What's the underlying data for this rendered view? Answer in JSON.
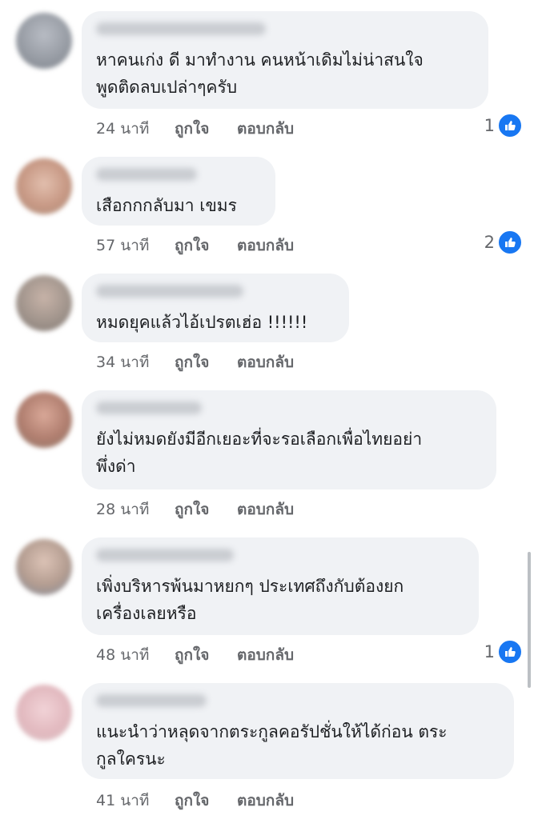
{
  "comments": [
    {
      "text_line1": "หาคนเก่ง ดี มาทำงาน คนหน้าเดิมไม่น่าสนใจ",
      "text_line2": "พูดติดลบเปล่าๆครับ",
      "time": "24 นาที",
      "like_label": "ถูกใจ",
      "reply_label": "ตอบกลับ",
      "reaction_count": "1",
      "avatar_color": "#9a9fa8"
    },
    {
      "text_line1": "เสือกกกลับมา เขมร",
      "text_line2": "",
      "time": "57 นาที",
      "like_label": "ถูกใจ",
      "reply_label": "ตอบกลับ",
      "reaction_count": "2",
      "avatar_color": "#c9a493"
    },
    {
      "text_line1": "หมดยุคแล้วไอ้เปรตเฮ่อ !!!!!!",
      "text_line2": "",
      "time": "34 นาที",
      "like_label": "ถูกใจ",
      "reply_label": "ตอบกลับ",
      "reaction_count": "",
      "avatar_color": "#a89a92"
    },
    {
      "text_line1": "ยังไม่หมดยังมีอีกเยอะที่จะรอเลือกเพื่อไทยอย่า",
      "text_line2": "พึ่งด่า",
      "time": "28 นาที",
      "like_label": "ถูกใจ",
      "reply_label": "ตอบกลับ",
      "reaction_count": "",
      "avatar_color": "#b98a7a"
    },
    {
      "text_line1": "เพิ่งบริหารพ้นมาหยกๆ ประเทศถึงกับต้องยก",
      "text_line2": "เครื่องเลยหรือ",
      "time": "48 นาที",
      "like_label": "ถูกใจ",
      "reply_label": "ตอบกลับ",
      "reaction_count": "1",
      "avatar_color": "#b39c90"
    },
    {
      "text_line1": "แนะนำว่าหลุดจากตระกูลคอรัปชั่นให้ได้ก่อน ตระ",
      "text_line2": "กูลใครนะ",
      "time": "41 นาที",
      "like_label": "ถูกใจ",
      "reply_label": "ตอบกลับ",
      "reaction_count": "",
      "avatar_color": "#e6c3c8"
    }
  ],
  "colors": {
    "bubble": "#f0f2f5",
    "like_blue": "#1877f2",
    "meta_gray": "#65676b"
  }
}
